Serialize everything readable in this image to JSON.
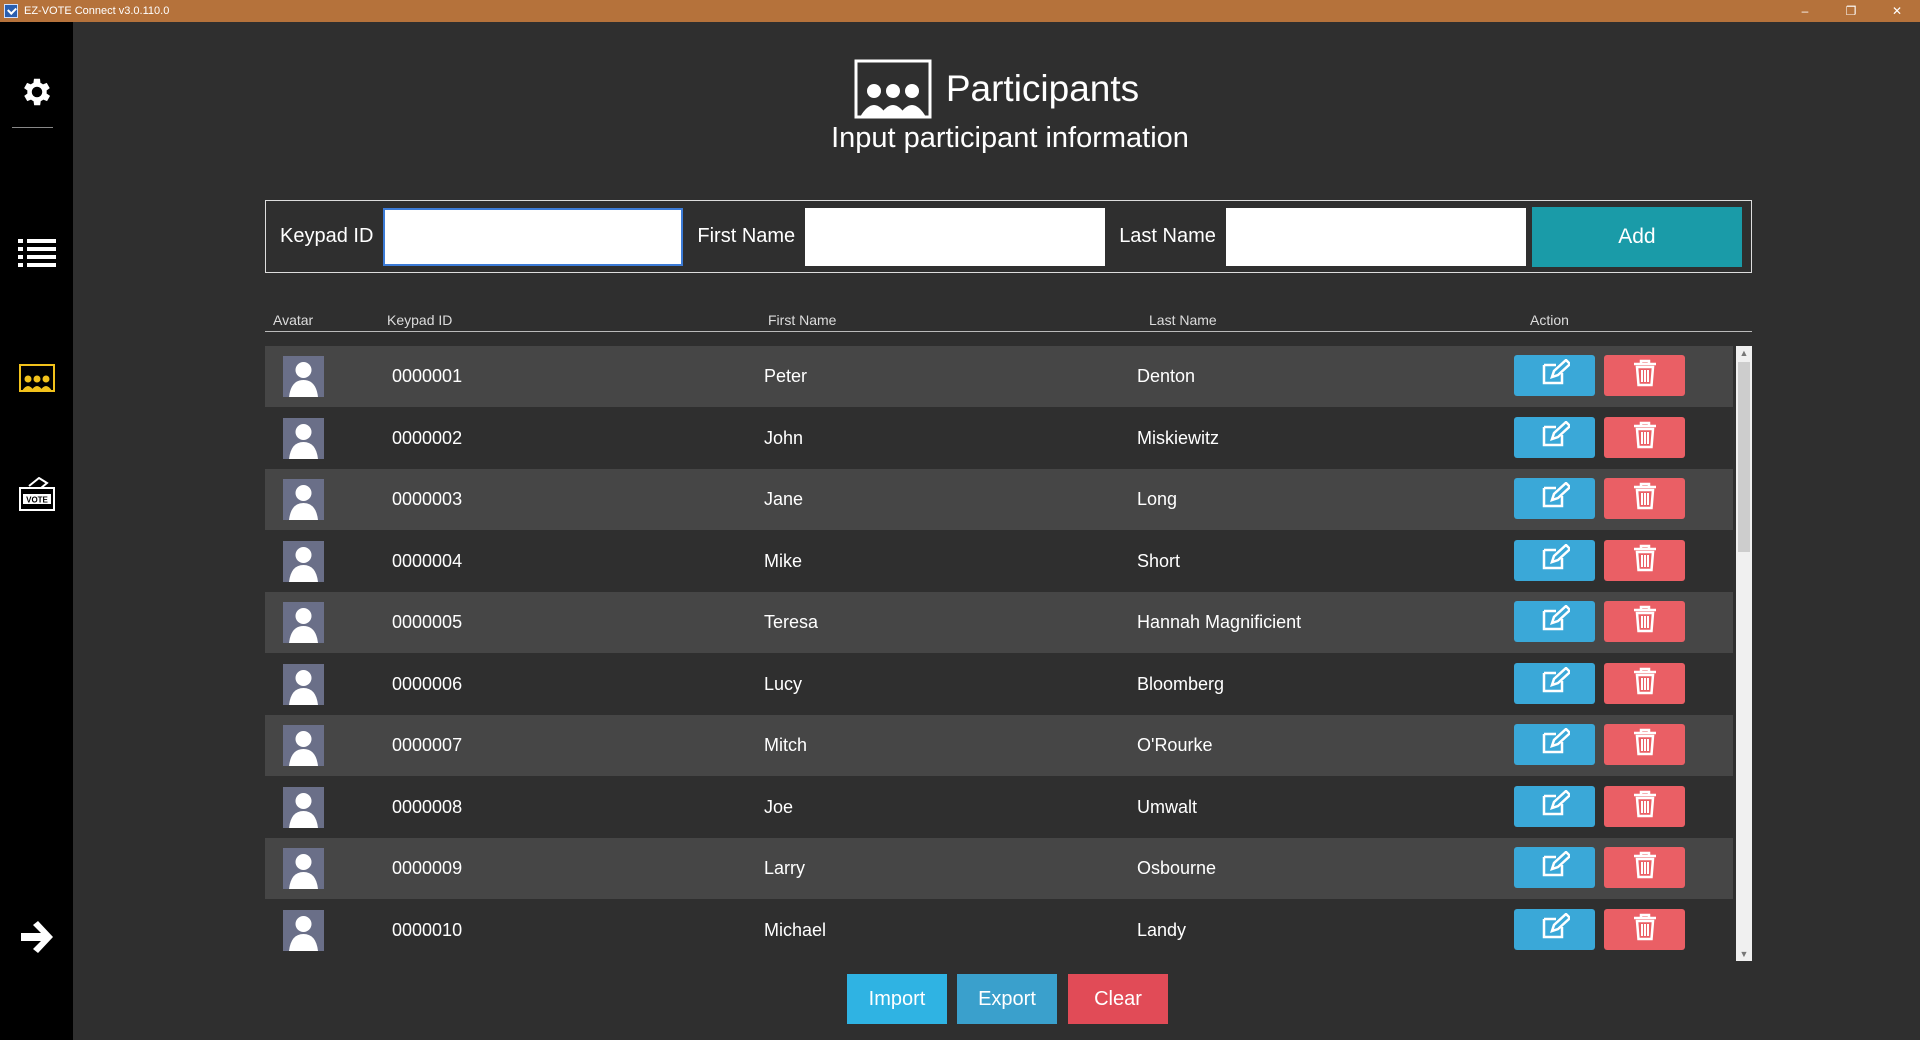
{
  "window": {
    "title": "EZ-VOTE Connect v3.0.110.0",
    "minimize_glyph": "–",
    "restore_glyph": "❐",
    "close_glyph": "✕"
  },
  "sidebar": {
    "items": [
      {
        "name": "settings",
        "icon": "gear-icon"
      },
      {
        "name": "list",
        "icon": "list-icon"
      },
      {
        "name": "participants",
        "icon": "participants-icon",
        "active": true
      },
      {
        "name": "vote",
        "icon": "vote-box-icon",
        "label": "VOTE"
      },
      {
        "name": "next",
        "icon": "arrow-right-icon"
      }
    ]
  },
  "header": {
    "title": "Participants",
    "subtitle": "Input participant information"
  },
  "form": {
    "keypad_label": "Keypad ID",
    "keypad_value": "",
    "first_label": "First Name",
    "first_value": "",
    "last_label": "Last Name",
    "last_value": "",
    "add_label": "Add"
  },
  "table": {
    "columns": [
      "Avatar",
      "Keypad ID",
      "First Name",
      "Last Name",
      "Action"
    ],
    "rows": [
      {
        "id": "0000001",
        "first": "Peter",
        "last": "Denton"
      },
      {
        "id": "0000002",
        "first": "John",
        "last": "Miskiewitz"
      },
      {
        "id": "0000003",
        "first": "Jane",
        "last": "Long"
      },
      {
        "id": "0000004",
        "first": "Mike",
        "last": "Short"
      },
      {
        "id": "0000005",
        "first": "Teresa",
        "last": "Hannah Magnificient"
      },
      {
        "id": "0000006",
        "first": "Lucy",
        "last": "Bloomberg"
      },
      {
        "id": "0000007",
        "first": "Mitch",
        "last": "O'Rourke"
      },
      {
        "id": "0000008",
        "first": "Joe",
        "last": "Umwalt"
      },
      {
        "id": "0000009",
        "first": "Larry",
        "last": "Osbourne"
      },
      {
        "id": "0000010",
        "first": "Michael",
        "last": "Landy"
      }
    ]
  },
  "footer": {
    "import_label": "Import",
    "export_label": "Export",
    "clear_label": "Clear"
  },
  "colors": {
    "titlebar": "#b5723b",
    "add": "#1a9ba8",
    "edit": "#3aa8d8",
    "delete": "#ea5f65",
    "import": "#2fb3e3",
    "export": "#3aa0cc",
    "clear": "#e14b57",
    "active_icon": "#f2c21b"
  }
}
